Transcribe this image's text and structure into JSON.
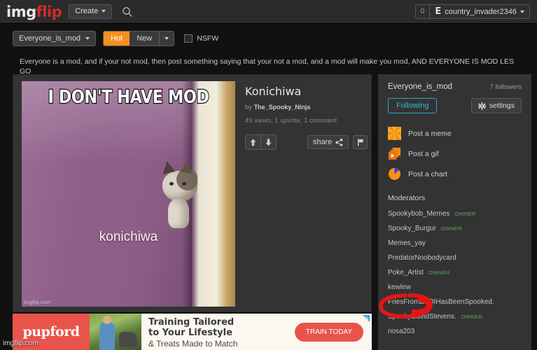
{
  "header": {
    "logo_img": "img",
    "logo_flip": "flip",
    "create_label": "Create",
    "search_icon": "search-icon",
    "notification_count": "0",
    "user_glyph": "E",
    "username": "country_invader2346"
  },
  "filterbar": {
    "stream_name": "Everyone_is_mod",
    "sort_hot": "Hot",
    "sort_new": "New",
    "nsfw_label": "NSFW"
  },
  "stream": {
    "description": "Everyone is a mod, and if your not mod, then post something saying that your not a mod, and a mod will make you mod, AND EVERYONE IS MOD LES GO"
  },
  "post": {
    "meme_top_text": "I DON'T HAVE MOD",
    "meme_bottom_text": "konichiwa",
    "meme_watermark": "imgflip.com",
    "title": "Konichiwa",
    "by_prefix": "by",
    "author": "The_Spooky_Ninja",
    "stats": "49 views, 1 upvote, 1 comment",
    "share_label": "share",
    "upvote_icon": "upvote-arrow-icon",
    "downvote_icon": "downvote-arrow-icon",
    "share_icon": "share-nodes-icon",
    "flag_icon": "flag-icon"
  },
  "sidebar": {
    "stream_title": "Everyone_is_mod",
    "followers": "7 followers",
    "following_label": "Following",
    "settings_label": "settings",
    "settings_icon": "gear-icon",
    "post_links": [
      {
        "label": "Post a meme",
        "icon": "starburst-meme-icon"
      },
      {
        "label": "Post a gif",
        "icon": "gif-stack-icon"
      },
      {
        "label": "Post a chart",
        "icon": "pie-chart-icon"
      }
    ],
    "moderators_title": "Moderators",
    "owner_badge": "OWNER",
    "moderators": [
      {
        "name": "Spookybob_Memes",
        "owner": true
      },
      {
        "name": "Spooky_Burgur",
        "owner": true
      },
      {
        "name": "Memes_yay",
        "owner": false
      },
      {
        "name": "PredatorNoobodycard",
        "owner": false
      },
      {
        "name": "Poke_Artist",
        "owner": true
      },
      {
        "name": "kewlew",
        "owner": false,
        "annotated": true
      },
      {
        "name": "FriesFromBFDIHasBeenSpooked.",
        "owner": false
      },
      {
        "name": "SpookyDavidStevens.",
        "owner": true
      },
      {
        "name": "nosa203",
        "owner": false
      }
    ]
  },
  "ad": {
    "brand": "pupford",
    "headline_line1": "Training Tailored",
    "headline_line2": "to Your Lifestyle",
    "subline": "& Treats Made to Match",
    "cta": "TRAIN TODAY",
    "ad_choices_icon": "ad-choices-icon"
  },
  "watermark": "imgflip.com",
  "colors": {
    "page_bg": "#111111",
    "header_bg": "#2b2b2b",
    "card_bg": "#333333",
    "accent_orange": "#f78f1e",
    "accent_cyan": "#35b9d6",
    "owner_green": "#5fa85f",
    "logo_red": "#d32b2b",
    "ad_red": "#e8544a",
    "annotation_red": "#e81414"
  }
}
